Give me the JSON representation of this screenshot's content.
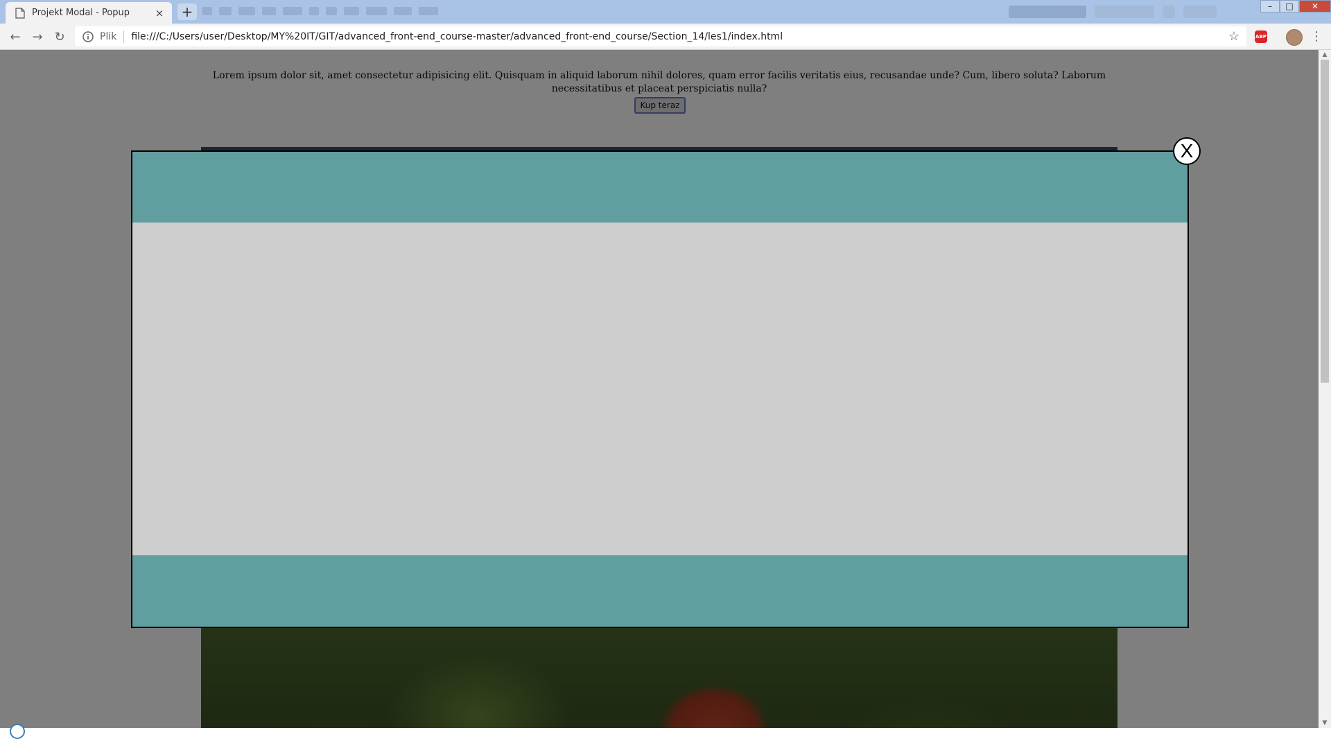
{
  "browser": {
    "tab": {
      "title": "Projekt Modal - Popup",
      "close_label": "×"
    },
    "newtab_label": "+",
    "window_controls": {
      "minimize": "–",
      "maximize": "□",
      "close": "✕"
    },
    "address": {
      "scheme_label": "Plik",
      "url": "file:///C:/Users/user/Desktop/MY%20IT/GIT/advanced_front-end_course-master/advanced_front-end_course/Section_14/les1/index.html"
    },
    "icons": [
      "back-icon",
      "forward-icon",
      "reload-icon",
      "info-icon",
      "star-icon",
      "adblock-icon",
      "profile-avatar",
      "menu-icon"
    ],
    "abp_label": "ABP",
    "nav": {
      "back": "←",
      "forward": "→",
      "reload": "↻"
    },
    "star": "☆",
    "menu": "⋮"
  },
  "page": {
    "intro_text": "Lorem ipsum dolor sit, amet consectetur adipisicing elit. Quisquam in aliquid laborum nihil dolores, quam error facilis veritatis eius, recusandae unde? Cum, libero soluta? Laborum necessitatibus et placeat perspiciatis nulla?",
    "buy_button": "Kup teraz",
    "overlay_color": "#000000",
    "modal": {
      "close_label": "X",
      "header_color": "#609ea0",
      "body_color": "#cecece",
      "footer_color": "#609ea0"
    }
  },
  "scrollbar": {
    "up": "▲",
    "down": "▼"
  }
}
